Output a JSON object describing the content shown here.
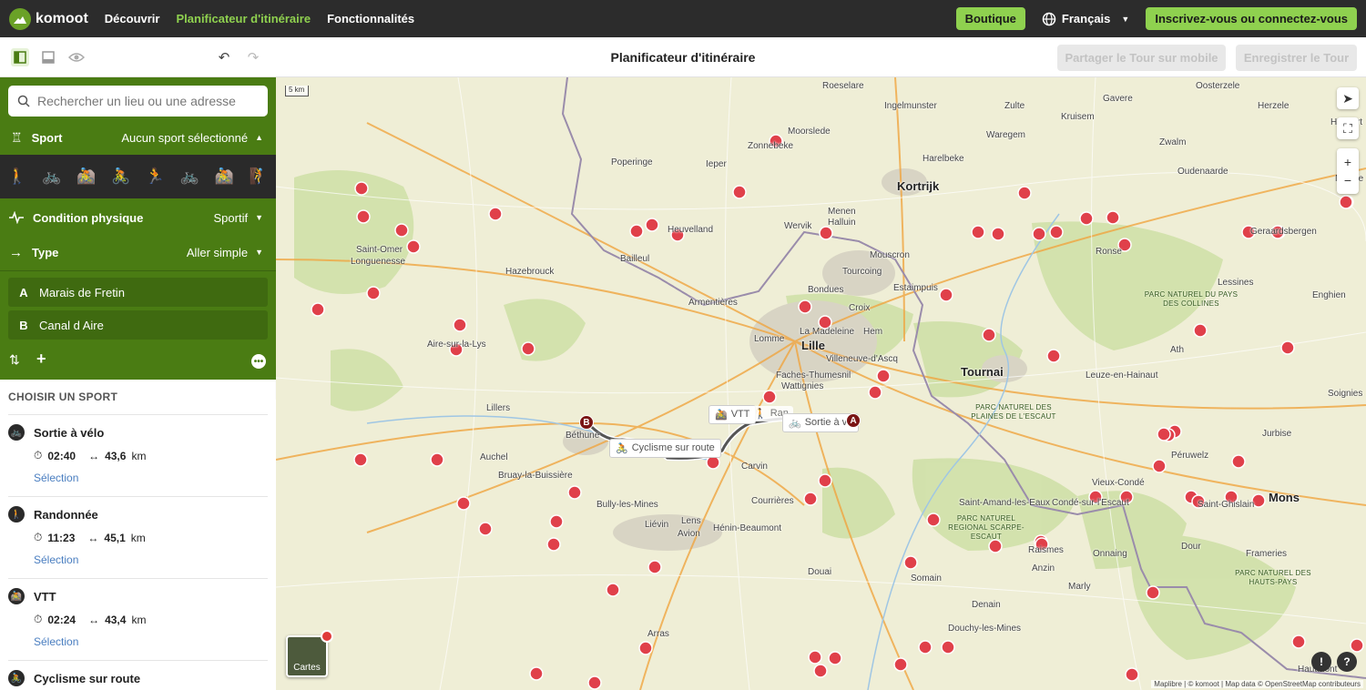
{
  "topbar": {
    "logo": "komoot",
    "nav": [
      {
        "label": "Découvrir",
        "active": false
      },
      {
        "label": "Planificateur d'itinéraire",
        "active": true
      },
      {
        "label": "Fonctionnalités",
        "active": false
      }
    ],
    "shop": "Boutique",
    "language": "Français",
    "signup": "Inscrivez-vous ou connectez-vous"
  },
  "toolbar": {
    "title": "Planificateur d'itinéraire",
    "share": "Partager le Tour sur mobile",
    "save": "Enregistrer le Tour"
  },
  "sidebar": {
    "search_placeholder": "Rechercher un lieu ou une adresse",
    "sport_label": "Sport",
    "sport_value": "Aucun sport sélectionné",
    "fitness_label": "Condition physique",
    "fitness_value": "Sportif",
    "type_label": "Type",
    "type_value": "Aller simple",
    "waypoints": [
      {
        "letter": "A",
        "name": "Marais de Fretin"
      },
      {
        "letter": "B",
        "name": "Canal d Aire"
      }
    ],
    "choose_title": "CHOISIR UN SPORT",
    "options": [
      {
        "name": "Sortie à vélo",
        "time": "02:40",
        "distance": "43,6",
        "unit": "km",
        "select": "Sélection"
      },
      {
        "name": "Randonnée",
        "time": "11:23",
        "distance": "45,1",
        "unit": "km",
        "select": "Sélection"
      },
      {
        "name": "VTT",
        "time": "02:24",
        "distance": "43,4",
        "unit": "km",
        "select": "Sélection"
      },
      {
        "name": "Cyclisme sur route",
        "time": "",
        "distance": "",
        "unit": "",
        "select": ""
      }
    ]
  },
  "map": {
    "scale": "5 km",
    "cartes": "Cartes",
    "attribution": "Maplibre | © komoot | Map data © OpenStreetMap contributeurs",
    "route_labels": [
      "VTT",
      "Ran",
      "Sortie à vé",
      "Cyclisme sur route"
    ],
    "marker_a": "A",
    "marker_b": "B",
    "cities_major": [
      "Lille",
      "Kortrijk",
      "Tournai",
      "Mons"
    ],
    "places": [
      "Roeselare",
      "Ingelmunster",
      "Zulte",
      "Gavere",
      "Oosterzele",
      "Kruisem",
      "Herzele",
      "Moorslede",
      "Waregem",
      "Zwalm",
      "Haaltert",
      "Zonnebeke",
      "Poperinge",
      "Ieper",
      "Harelbeke",
      "Oudenaarde",
      "Ninove",
      "Menen",
      "Halluin",
      "Wervik",
      "Heuvelland",
      "Bailleul",
      "Mouscron",
      "Ronse",
      "Geraardsbergen",
      "Saint-Omer",
      "Longuenesse",
      "Hazebrouck",
      "Tourcoing",
      "Estaimpuis",
      "Lessines",
      "Enghien",
      "Armentières",
      "Bondues",
      "Croix",
      "Lomme",
      "La Madeleine",
      "Hem",
      "Ath",
      "Villeneuve-d'Ascq",
      "Aire-sur-la-Lys",
      "Faches-Thumesnil",
      "Wattignies",
      "Leuze-en-Hainaut",
      "Soignies",
      "Lillers",
      "Béthune",
      "Carvin",
      "Péruwelz",
      "Jurbise",
      "Auchel",
      "Bruay-la-Buissière",
      "Vieux-Condé",
      "Saint-Amand-les-Eaux",
      "Condé-sur-l'Escaut",
      "Saint-Ghislain",
      "Bully-les-Mines",
      "Courrières",
      "Liévin",
      "Lens",
      "Hénin-Beaumont",
      "Avion",
      "Raismes",
      "Frameries",
      "Dour",
      "Somain",
      "Onnaing",
      "Douai",
      "Anzin",
      "Marly",
      "Denain",
      "Douchy-les-Mines",
      "Arras",
      "Hautmont"
    ],
    "parks": [
      "PARC NATUREL DU PAYS DES COLLINES",
      "PARC NATUREL DES PLAINES DE L'ESCAUT",
      "PARC NATUREL REGIONAL SCARPE-ESCAUT",
      "PARC NATUREL DES HAUTS-PAYS"
    ]
  },
  "colors": {
    "brand": "#8fd14f",
    "sidebar_green": "#4a7c13",
    "route": "#555555",
    "poi": "#e0404a"
  }
}
